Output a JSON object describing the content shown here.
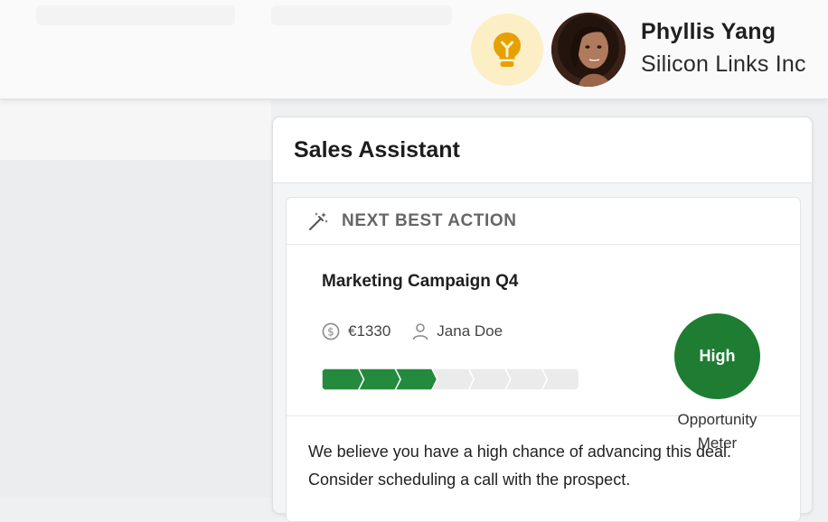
{
  "user": {
    "name": "Phyllis Yang",
    "company": "Silicon Links Inc"
  },
  "assistant": {
    "title": "Sales Assistant",
    "card": {
      "header_label": "NEXT BEST ACTION",
      "deal": {
        "title": "Marketing Campaign Q4",
        "amount": "€1330",
        "owner": "Jana Doe",
        "progress": {
          "completed_steps": 3,
          "total_steps": 7
        }
      },
      "meter": {
        "level": "High",
        "label_line1": "Opportunity",
        "label_line2": "Meter"
      },
      "recommendation": {
        "line1": "We believe you have a high chance of advancing this deal.",
        "line2": "Consider scheduling a call with the prospect."
      }
    }
  },
  "colors": {
    "accent_green": "#1e7d32",
    "progress_green": "#248a3d",
    "bulb_bg": "#fcefc6",
    "bulb_icon": "#e6a100"
  },
  "icons": {
    "bulb": "lightbulb-icon",
    "wand": "magic-wand-icon",
    "amount": "dollar-circle-icon",
    "owner": "person-icon"
  }
}
